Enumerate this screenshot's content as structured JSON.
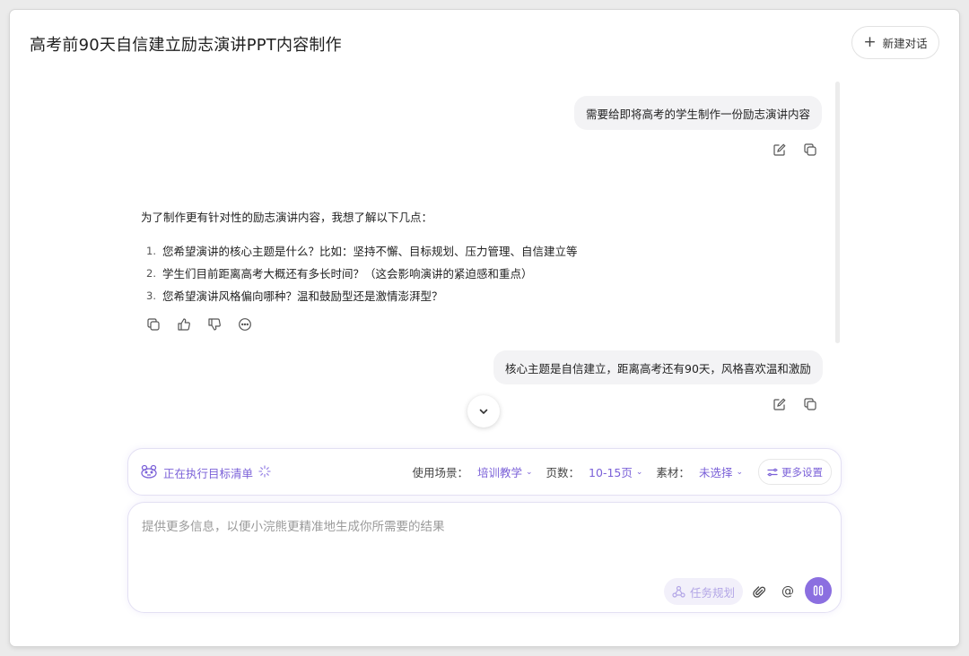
{
  "header": {
    "title": "高考前90天自信建立励志演讲PPT内容制作",
    "new_chat_label": "新建对话"
  },
  "messages": {
    "user_1": "需要给即将高考的学生制作一份励志演讲内容",
    "assistant_intro": "为了制作更有针对性的励志演讲内容，我想了解以下几点：",
    "assistant_items": [
      {
        "num": "1.",
        "text": "您希望演讲的核心主题是什么？比如：坚持不懈、目标规划、压力管理、自信建立等"
      },
      {
        "num": "2.",
        "text": "学生们目前距离高考大概还有多长时间？（这会影响演讲的紧迫感和重点）"
      },
      {
        "num": "3.",
        "text": "您希望演讲风格偏向哪种？温和鼓励型还是激情澎湃型？"
      }
    ],
    "user_2": "核心主题是自信建立，距离高考还有90天，风格喜欢温和激励"
  },
  "status_bar": {
    "executing_label": "正在执行目标清单",
    "scene_label": "使用场景：",
    "scene_value": "培训教学",
    "pages_label": "页数：",
    "pages_value": "10-15页",
    "material_label": "素材：",
    "material_value": "未选择",
    "more_settings_label": "更多设置"
  },
  "composer": {
    "placeholder": "提供更多信息，以便小浣熊更精准地生成你所需要的结果",
    "task_plan_label": "任务规划",
    "at_symbol": "@"
  },
  "colors": {
    "accent": "#7b61d8",
    "send_button": "#8b6fe0",
    "bubble_bg": "#f3f3f5"
  }
}
